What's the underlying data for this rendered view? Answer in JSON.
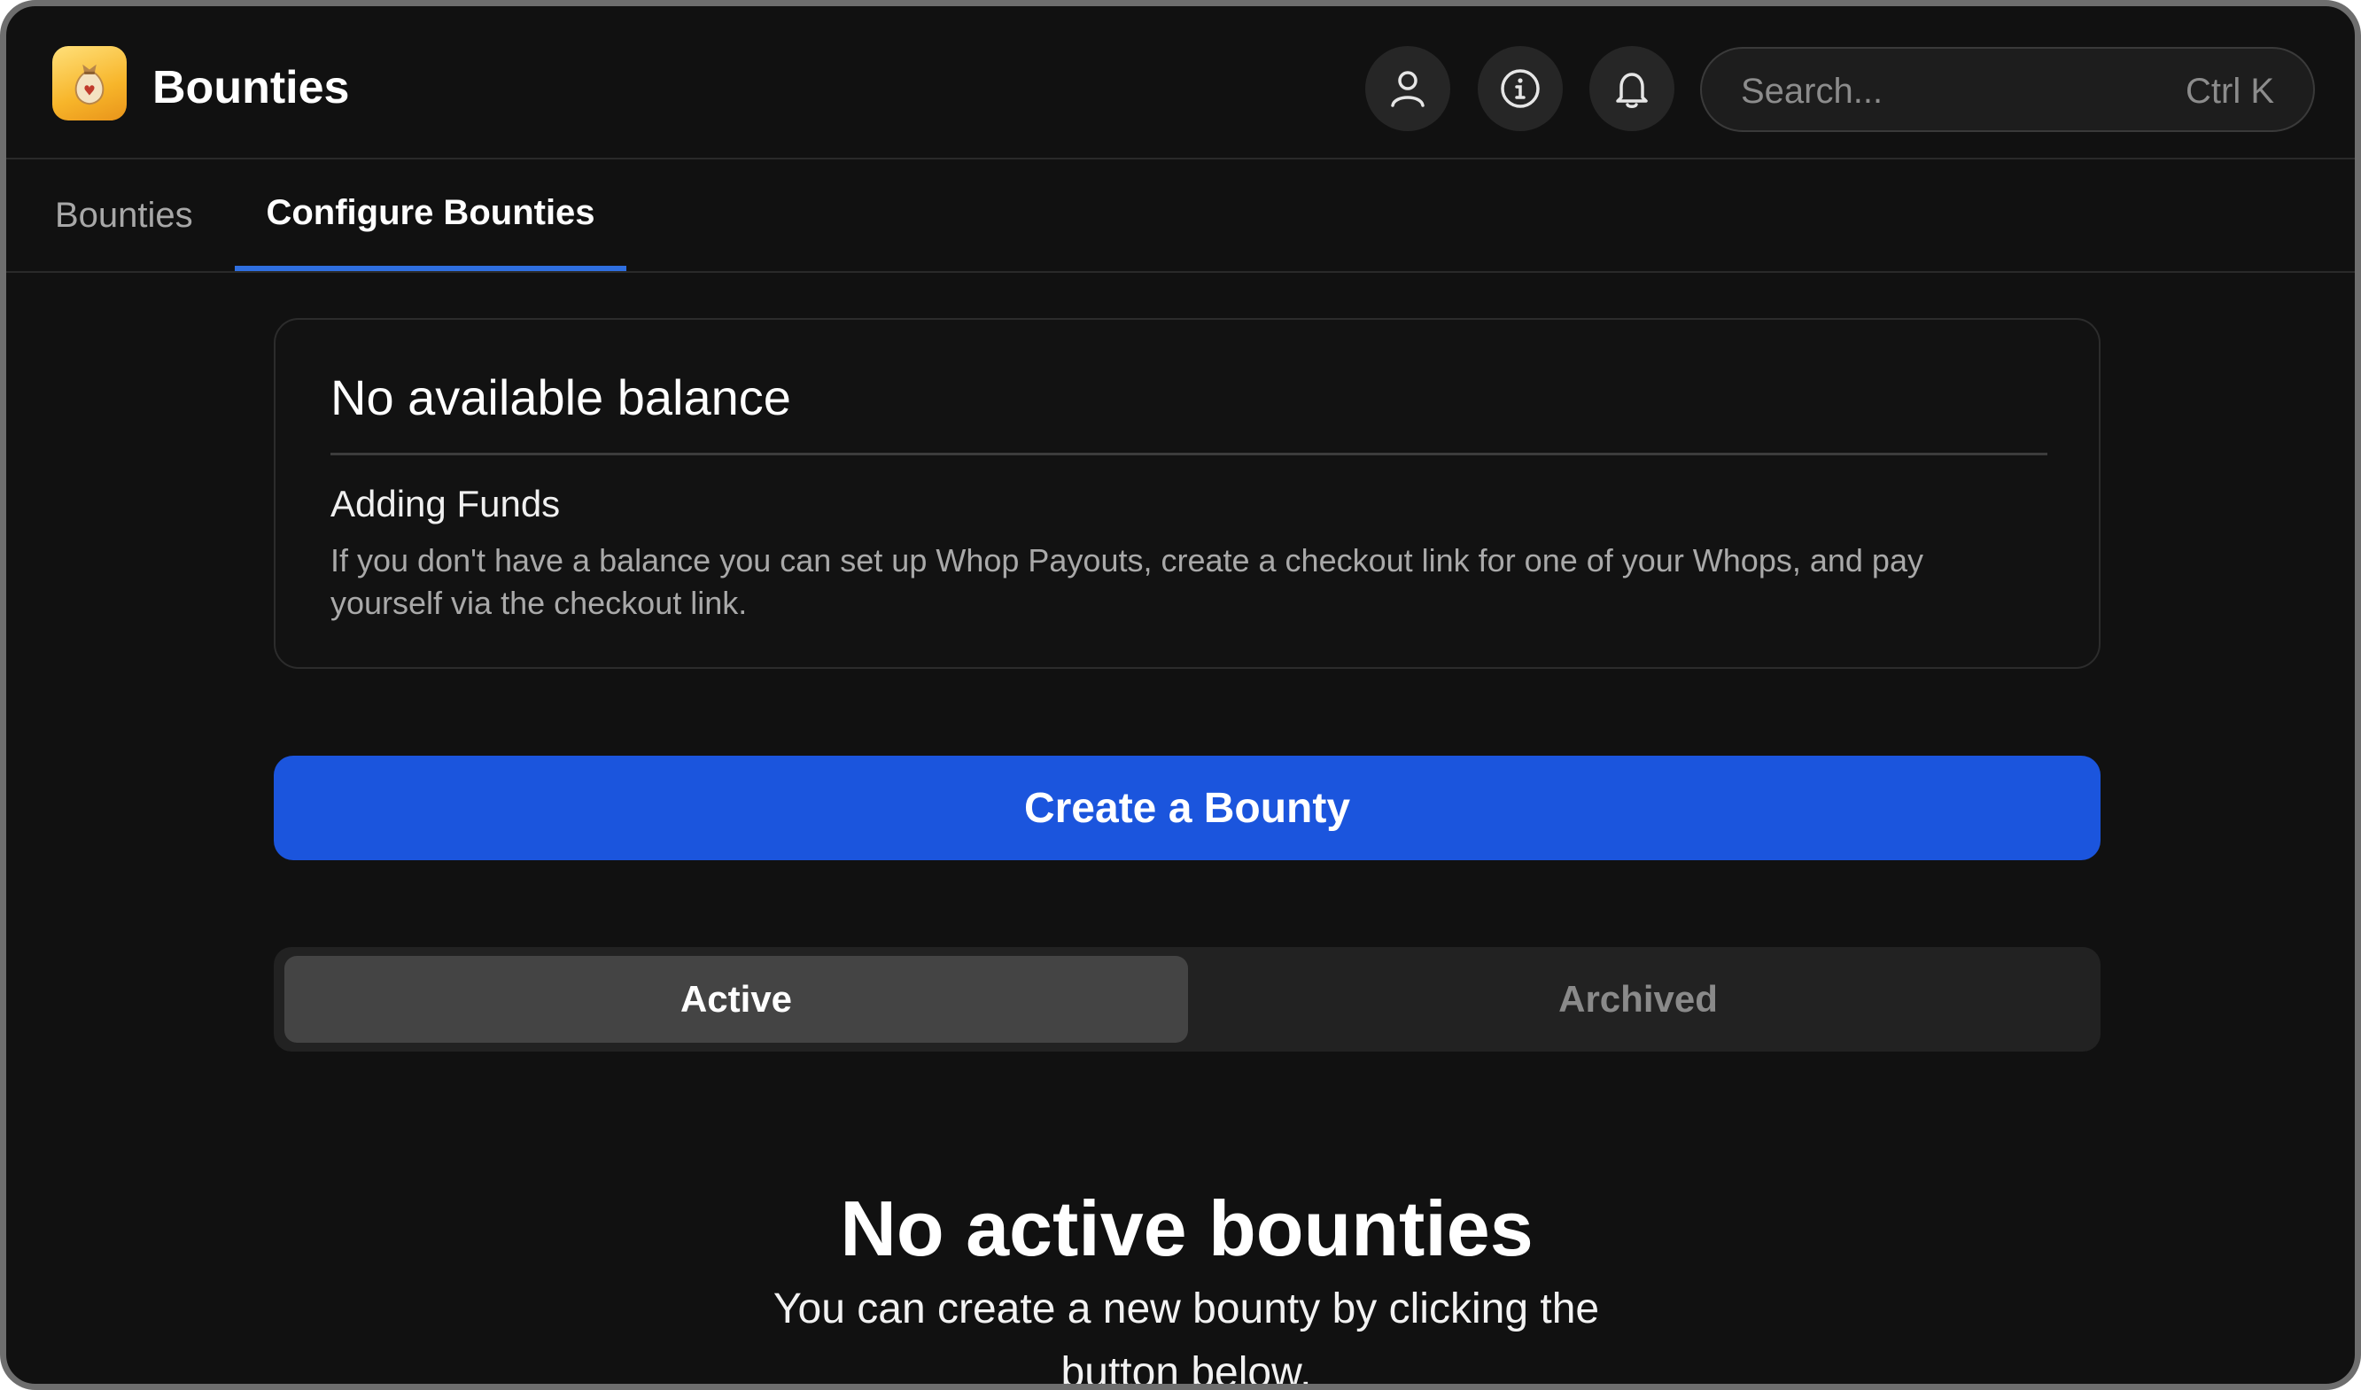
{
  "app": {
    "title": "Bounties",
    "logo_icon": "money-bag-icon",
    "accent_color": "#1b55dd"
  },
  "header": {
    "buttons": [
      {
        "name": "user-icon"
      },
      {
        "name": "info-icon"
      },
      {
        "name": "bell-icon"
      }
    ],
    "search": {
      "placeholder": "Search...",
      "shortcut": "Ctrl K"
    }
  },
  "tabs": [
    {
      "label": "Bounties",
      "active": false
    },
    {
      "label": "Configure Bounties",
      "active": true
    }
  ],
  "balance_card": {
    "title": "No available balance",
    "subtitle": "Adding Funds",
    "body": "If you don't have a balance you can set up Whop Payouts, create a checkout link for one of your Whops, and pay yourself via the checkout link."
  },
  "create_button": {
    "label": "Create a Bounty"
  },
  "segments": {
    "active_label": "Active",
    "archived_label": "Archived",
    "selected": "Active"
  },
  "empty_state": {
    "title": "No active bounties",
    "text": "You can create a new bounty by clicking the button below."
  }
}
